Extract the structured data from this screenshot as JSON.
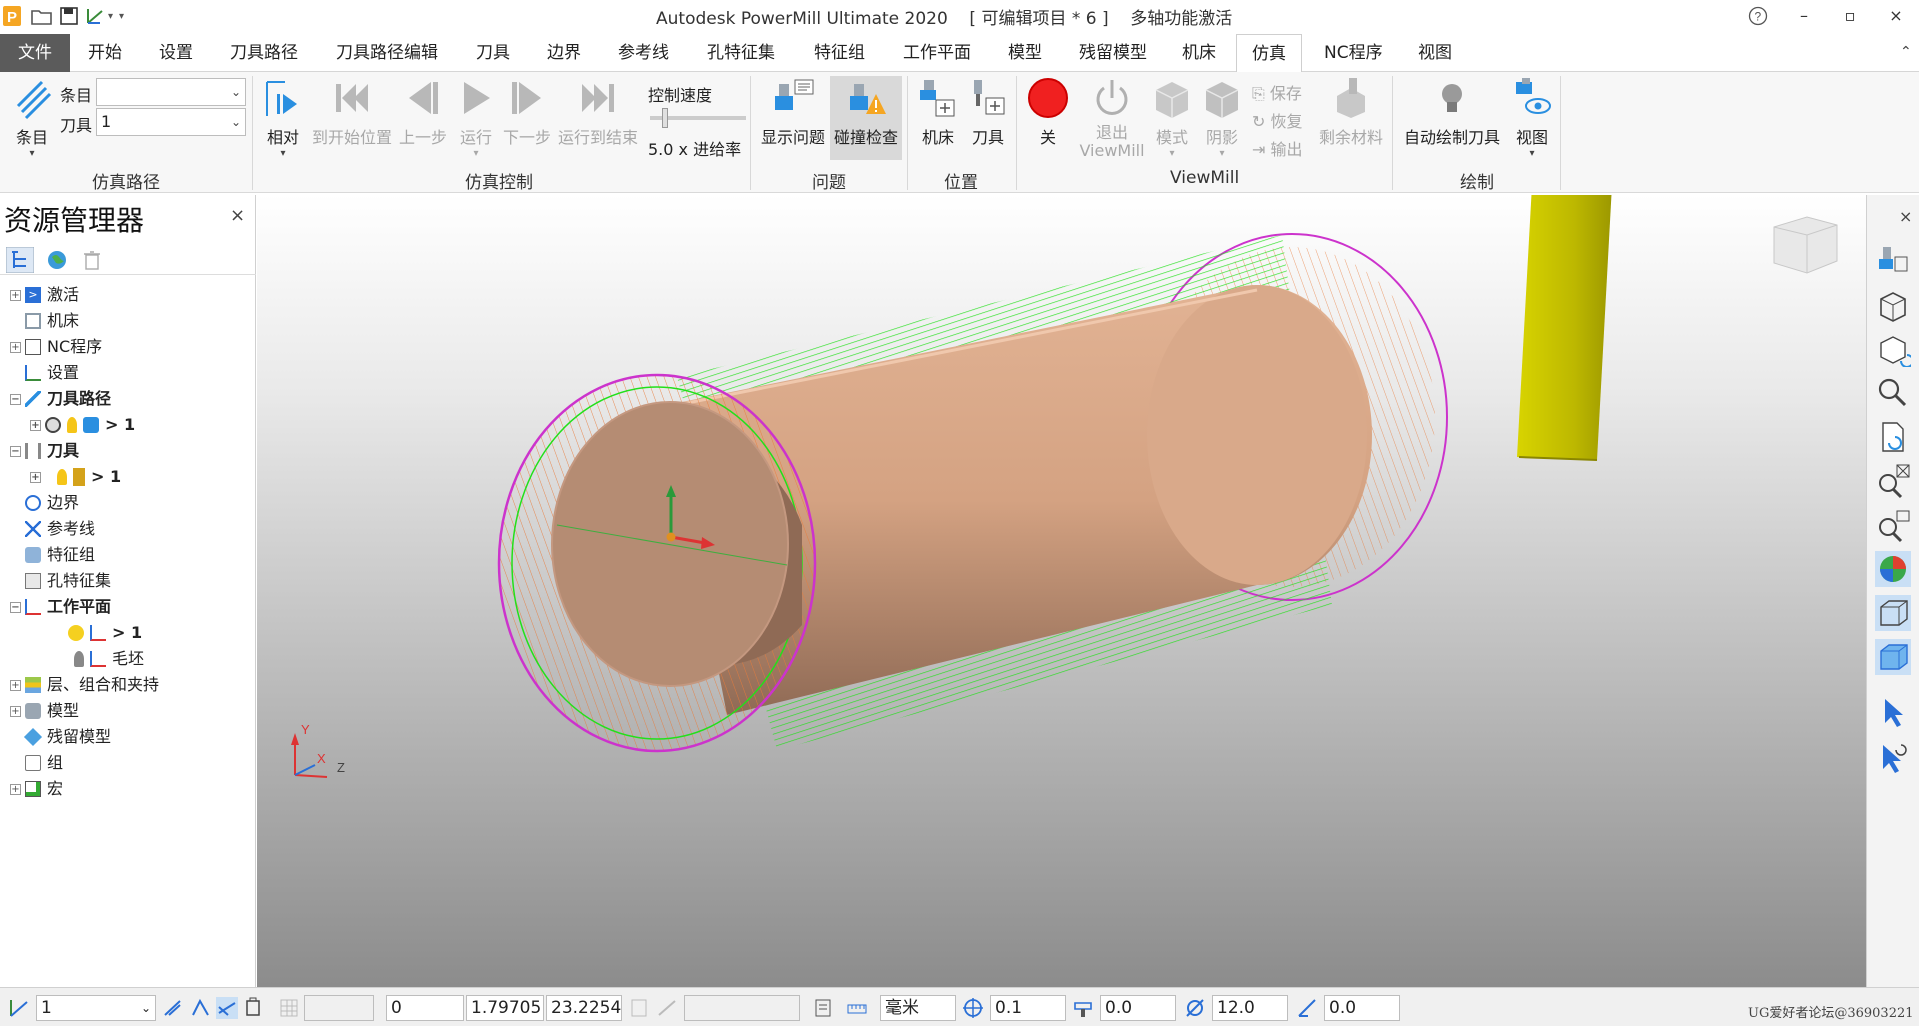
{
  "titlebar": {
    "app_title": "Autodesk PowerMill Ultimate 2020",
    "project": "[ 可编辑项目 * 6 ]",
    "license": "多轴功能激活",
    "help": "?",
    "minimize": "–",
    "restore": "▫",
    "close": "×"
  },
  "tabs": [
    "文件",
    "开始",
    "设置",
    "刀具路径",
    "刀具路径编辑",
    "刀具",
    "边界",
    "参考线",
    "孔特征集",
    "特征组",
    "工作平面",
    "模型",
    "残留模型",
    "机床",
    "仿真",
    "NC程序",
    "视图"
  ],
  "active_tab": "仿真",
  "ribbon": {
    "sim_path": {
      "label": "仿真路径",
      "entry_btn": "条目",
      "entry_label": "条目",
      "entry_value": "",
      "tool_label": "刀具",
      "tool_value": "1"
    },
    "sim_control": {
      "label": "仿真控制",
      "relative": "相对",
      "to_start": "到开始位置",
      "prev": "上一步",
      "run": "运行",
      "next": "下一步",
      "run_to_end": "运行到结束",
      "speed_label": "控制速度",
      "speed_value": "5.0 x 进给率"
    },
    "issues": {
      "label": "问题",
      "show_issues": "显示问题",
      "collision_check": "碰撞检查"
    },
    "position": {
      "label": "位置",
      "machine": "机床",
      "tool": "刀具"
    },
    "viewmill": {
      "label": "ViewMill",
      "off": "关",
      "exit_line1": "退出",
      "exit_line2": "ViewMill",
      "mode": "模式",
      "shade": "阴影",
      "save": "保存",
      "restore": "恢复",
      "export": "输出",
      "remaining": "剩余材料"
    },
    "draw": {
      "label": "绘制",
      "auto_draw_tool": "自动绘制刀具",
      "view": "视图"
    }
  },
  "explorer": {
    "title": "资源管理器",
    "close": "×",
    "items": [
      {
        "label": "激活",
        "bold": false
      },
      {
        "label": "机床",
        "bold": false
      },
      {
        "label": "NC程序",
        "bold": false
      },
      {
        "label": "设置",
        "bold": false
      },
      {
        "label": "刀具路径",
        "bold": true
      },
      {
        "label": "> 1",
        "bold": true
      },
      {
        "label": "刀具",
        "bold": true
      },
      {
        "label": "> 1",
        "bold": true
      },
      {
        "label": "边界",
        "bold": false
      },
      {
        "label": "参考线",
        "bold": false
      },
      {
        "label": "特征组",
        "bold": false
      },
      {
        "label": "孔特征集",
        "bold": false
      },
      {
        "label": "工作平面",
        "bold": true
      },
      {
        "label": "> 1",
        "bold": true
      },
      {
        "label": "毛坯",
        "bold": false
      },
      {
        "label": "层、组合和夹持",
        "bold": false
      },
      {
        "label": "模型",
        "bold": false
      },
      {
        "label": "残留模型",
        "bold": false
      },
      {
        "label": "组",
        "bold": false
      },
      {
        "label": "宏",
        "bold": false
      }
    ]
  },
  "viewport": {
    "axis_y": "Y",
    "axis_x": "X",
    "axis_z": "Z"
  },
  "rightbar": {
    "close": "×"
  },
  "statusbar": {
    "workplane": "1",
    "coord_1": "0",
    "coord_2": "1.79705",
    "coord_3": "23.2254",
    "units": "毫米",
    "tolerance": "0.1",
    "thickness": "0.0",
    "diameter": "12.0",
    "angle": "0.0",
    "watermark": "UG爱好者论坛@36903221"
  }
}
